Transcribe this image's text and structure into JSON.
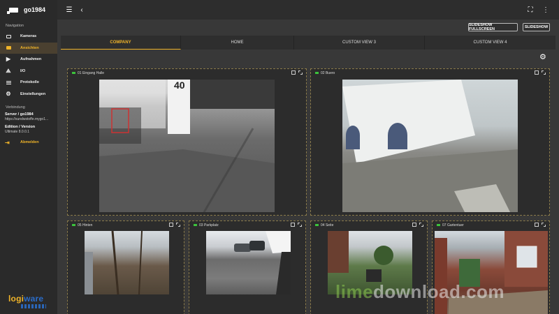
{
  "app": {
    "title": "go1984"
  },
  "sidebar": {
    "nav_heading": "Navigation",
    "items": [
      {
        "label": "Kameras",
        "icon": "camera-icon"
      },
      {
        "label": "Ansichten",
        "icon": "views-icon",
        "active": true
      },
      {
        "label": "Aufnahmen",
        "icon": "recordings-icon"
      },
      {
        "label": "I/O",
        "icon": "io-icon"
      },
      {
        "label": "Protokolle",
        "icon": "log-icon"
      },
      {
        "label": "Einstellungen",
        "icon": "gear-icon"
      }
    ],
    "connection_heading": "Verbindung",
    "server_label": "Server / go1984",
    "server_value": "https://sundwstoffe.mygo1...",
    "edition_label": "Edition / Version",
    "edition_value": "Ultimate 8.0.0.1",
    "logout_label": "Abmelden",
    "logo_text_a": "logi",
    "logo_text_b": "ware"
  },
  "toolbar": {
    "slideshow_fullscreen": "SLIDESHOW FULLSCREEN",
    "slideshow": "SLIDESHOW"
  },
  "tabs": [
    {
      "label": "COMPANY",
      "active": true
    },
    {
      "label": "HOME"
    },
    {
      "label": "CUSTOM VIEW 3"
    },
    {
      "label": "CUSTOM VIEW 4"
    }
  ],
  "cameras": [
    {
      "name": "01 Eingang Halle",
      "overlay": "40"
    },
    {
      "name": "02 Buero",
      "overlay": ""
    },
    {
      "name": "05 Hinten"
    },
    {
      "name": "03 Parkplatz"
    },
    {
      "name": "04 Seite"
    },
    {
      "name": "07 Gartentuer"
    }
  ],
  "watermark": {
    "a": "lime",
    "b": "download.com"
  },
  "colors": {
    "accent": "#f0b429",
    "status_live": "#3cc43c"
  }
}
